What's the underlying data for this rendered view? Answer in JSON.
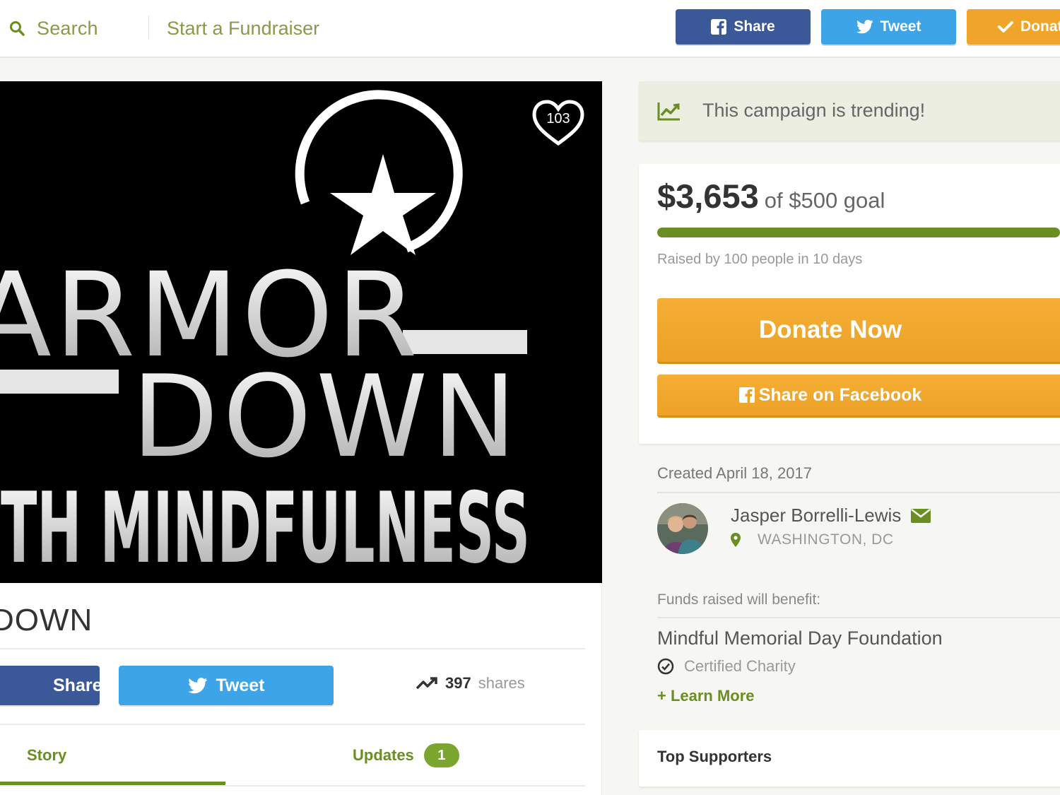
{
  "header": {
    "search_label": "Search",
    "start_label": "Start a Fundraiser",
    "share_label": "Share",
    "tweet_label": "Tweet",
    "donate_label": "Donat"
  },
  "hero": {
    "like_count": "103",
    "logo_line1": "ARMOR",
    "logo_line2": "DOWN",
    "logo_line3": "WITH MINDFULNESS"
  },
  "campaign": {
    "title": "DOWN",
    "share_label": "Share",
    "tweet_label": "Tweet",
    "shares_count": "397",
    "shares_word": "shares",
    "tabs": [
      {
        "label": "Story"
      },
      {
        "label": "Updates",
        "badge": "1"
      }
    ]
  },
  "sidebar": {
    "trending_text": "This campaign is trending!",
    "amount_raised": "$3,653",
    "goal_text": "of $500 goal",
    "progress_fraction": 1.0,
    "raised_by": "Raised by 100 people in 10 days",
    "donate_now": "Donate Now",
    "share_facebook": "Share on Facebook",
    "created": "Created April 18, 2017",
    "organizer_name": "Jasper Borrelli-Lewis",
    "organizer_location": "WASHINGTON, DC",
    "benefit_label": "Funds raised will benefit:",
    "charity_name": "Mindful Memorial Day Foundation",
    "certified_label": "Certified Charity",
    "learn_more": "+ Learn More",
    "top_supporters": "Top Supporters"
  },
  "colors": {
    "brand_green": "#6a8e22",
    "facebook_blue": "#3b5998",
    "twitter_blue": "#3da4e8",
    "donate_orange": "#f0a42a"
  }
}
